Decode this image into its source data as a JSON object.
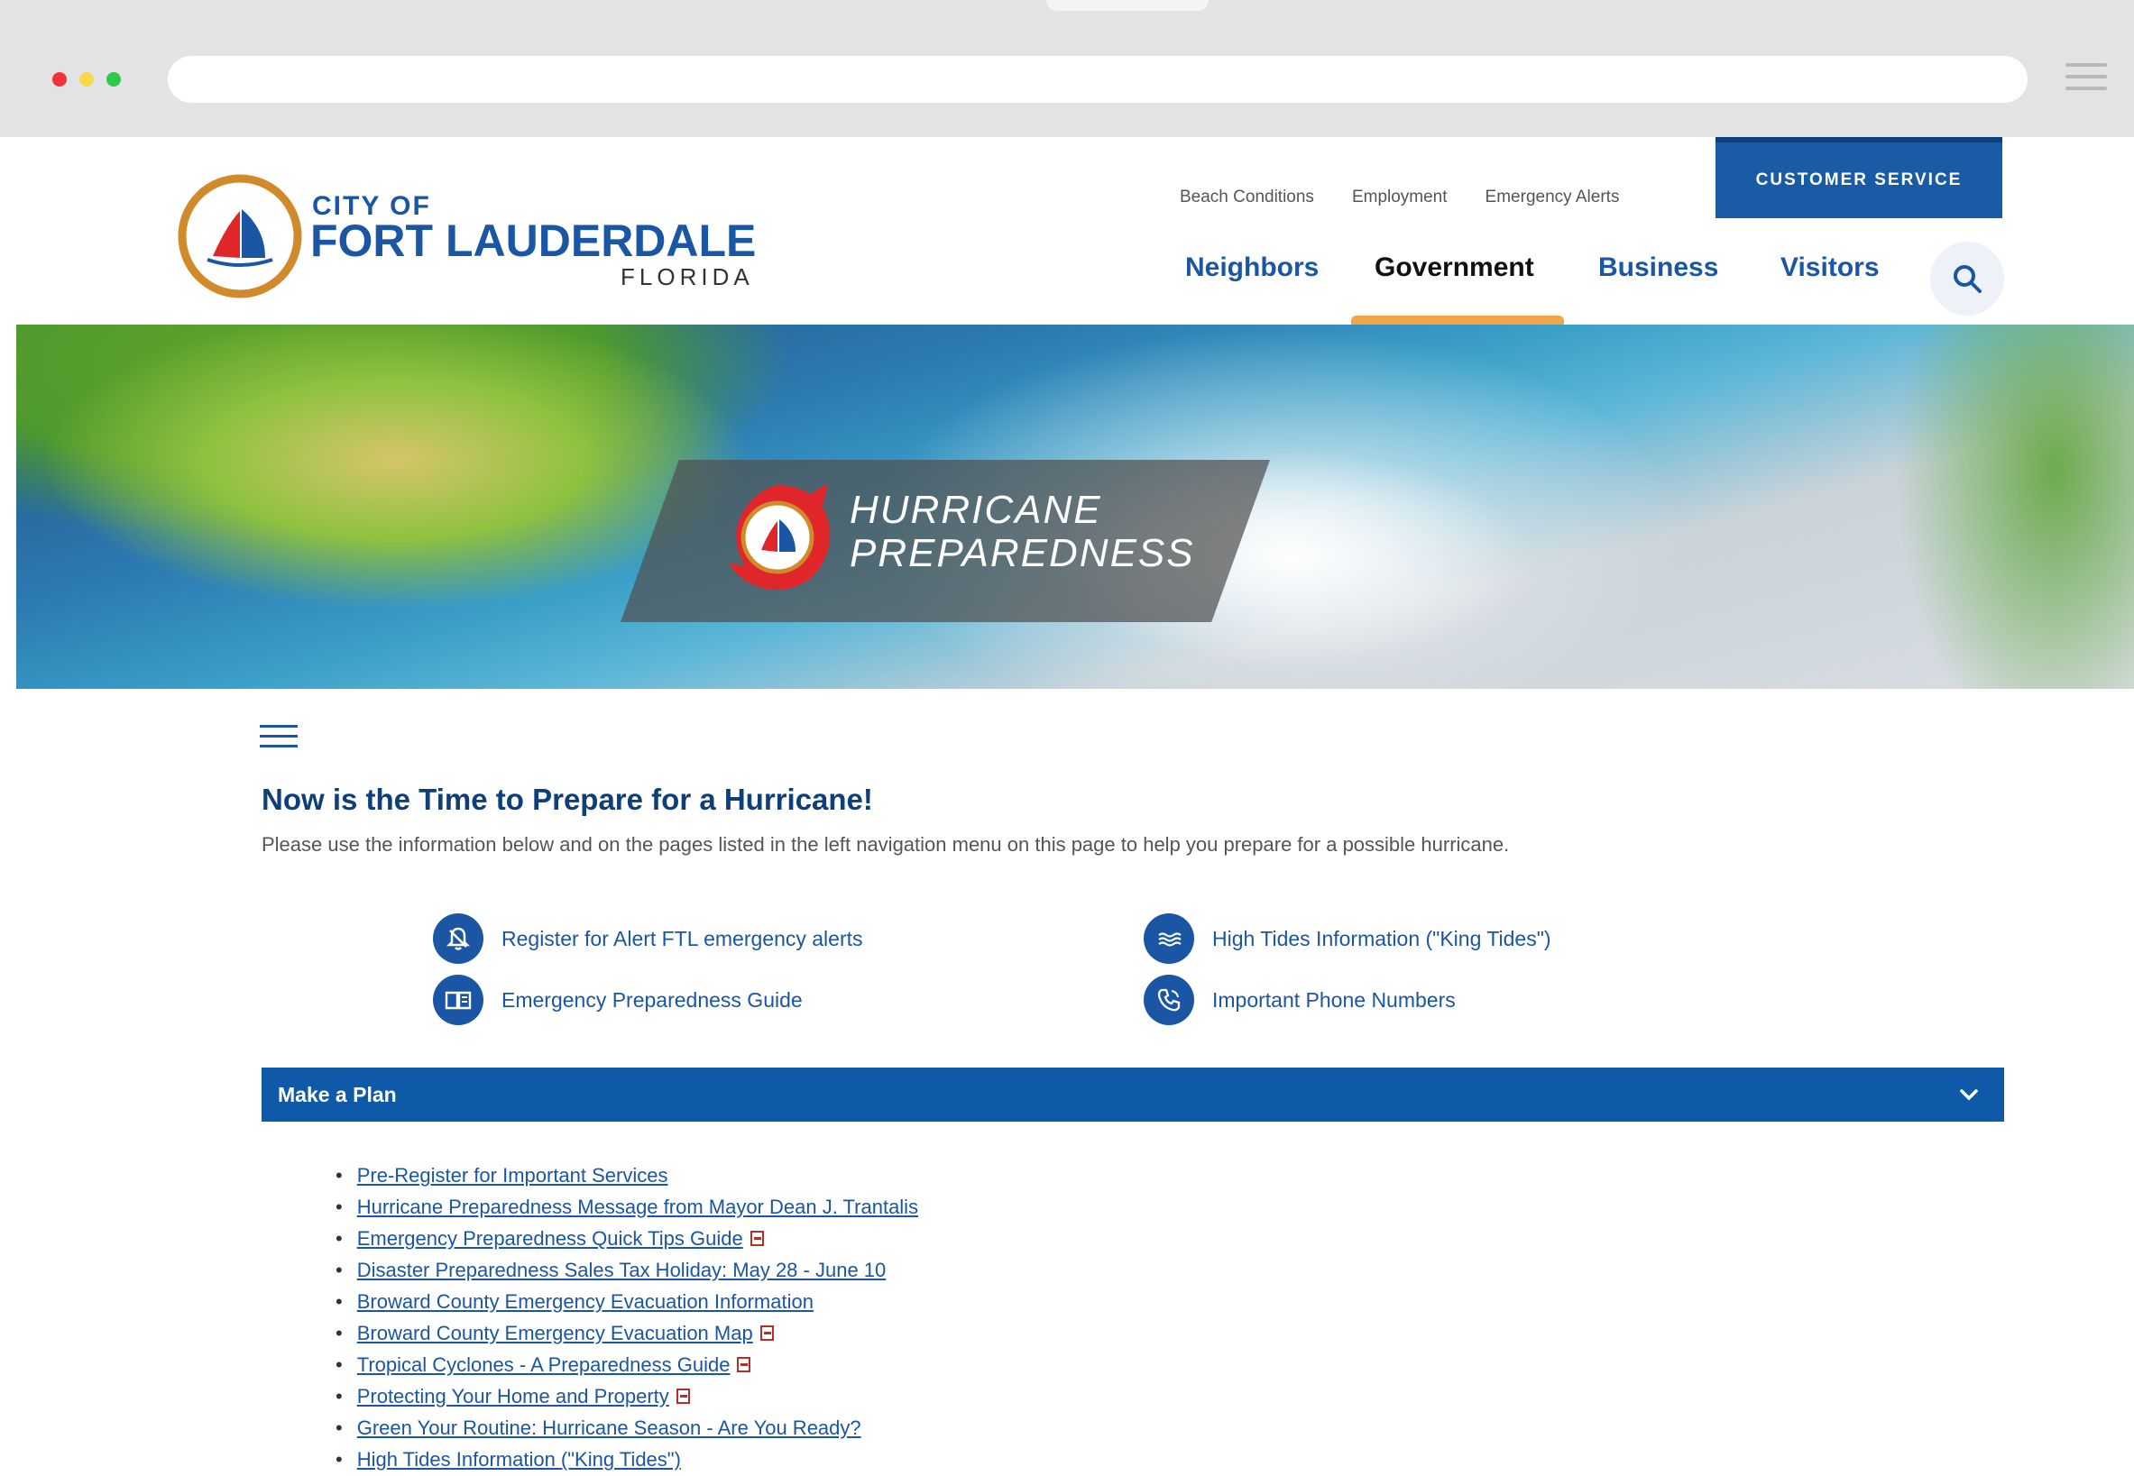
{
  "browser": {
    "url": ""
  },
  "header": {
    "logo": {
      "city_of": "CITY OF",
      "name": "FORT LAUDERDALE",
      "state": "FLORIDA"
    },
    "utility_links": [
      "Beach Conditions",
      "Employment",
      "Emergency Alerts"
    ],
    "customer_service": "CUSTOMER SERVICE",
    "nav": [
      {
        "label": "Neighbors"
      },
      {
        "label": "Government"
      },
      {
        "label": "Business"
      },
      {
        "label": "Visitors"
      }
    ],
    "active_nav": "Government"
  },
  "hero": {
    "title_line1": "HURRICANE",
    "title_line2": "PREPAREDNESS"
  },
  "content": {
    "title": "Now is the Time to Prepare for a Hurricane!",
    "intro": "Please use the information below and on the pages listed in the left navigation menu on this page to help you prepare for a possible hurricane.",
    "quick_links": [
      {
        "label": "Register for Alert FTL emergency alerts",
        "icon": "alert-bell-icon"
      },
      {
        "label": "High Tides Information (\"King Tides\")",
        "icon": "waves-icon"
      },
      {
        "label": "Emergency Preparedness Guide",
        "icon": "book-icon"
      },
      {
        "label": "Important Phone Numbers",
        "icon": "phone-icon"
      }
    ],
    "accordion": {
      "title": "Make a Plan",
      "links": [
        {
          "label": "Pre-Register for Important Services",
          "pdf": false
        },
        {
          "label": "Hurricane Preparedness Message from Mayor Dean J. Trantalis",
          "pdf": false
        },
        {
          "label": "Emergency Preparedness Quick Tips Guide",
          "pdf": true
        },
        {
          "label": "Disaster Preparedness Sales Tax Holiday: May 28 - June 10",
          "pdf": false
        },
        {
          "label": "Broward County Emergency Evacuation Information",
          "pdf": false
        },
        {
          "label": "Broward County Emergency Evacuation Map",
          "pdf": true
        },
        {
          "label": "Tropical Cyclones - A Preparedness Guide",
          "pdf": true
        },
        {
          "label": "Protecting Your Home and Property",
          "pdf": true
        },
        {
          "label": "Green Your Routine: Hurricane Season - Are You Ready?",
          "pdf": false
        },
        {
          "label": "High Tides Information (\"King Tides\")",
          "pdf": false
        }
      ]
    }
  },
  "colors": {
    "brand_blue": "#1a56a4",
    "accent_orange": "#f2a446",
    "accordion_blue": "#0f5aa8"
  }
}
